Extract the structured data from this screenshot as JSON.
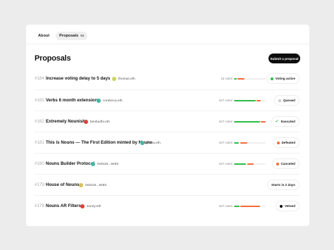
{
  "tabs": [
    {
      "label": "About",
      "count": ""
    },
    {
      "label": "Proposals",
      "count": "84"
    }
  ],
  "page_title": "Proposals",
  "submit_label": "Submit a proposal",
  "colors": {
    "for": "#2cbc46",
    "against": "#f26a3b",
    "active": "#2cbc46",
    "queued": "#c8c8c8",
    "defeated": "#f26a3b",
    "canceled": "#f26a3b",
    "vetoed": "#111111"
  },
  "proposals": [
    {
      "num": "#184",
      "title": "Increase voting delay to 5 days",
      "author": "thomas.eth",
      "avatar_color": "#c9d36a",
      "votes": "16 votes",
      "for": 0.08,
      "against": 0.22,
      "status": "Voting active",
      "status_icon": "dot-icon",
      "status_color": "#2cbc46"
    },
    {
      "num": "#183",
      "title": "Verbs 6 month extension",
      "author": "coralorca.eth",
      "avatar_color": "#43b6a3",
      "votes": "647 votes",
      "for": 0.68,
      "against": 0.14,
      "status": "Queued",
      "status_icon": "dot-icon",
      "status_color": "#c8c8c8"
    },
    {
      "num": "#182",
      "title": "Extremely Nounish",
      "author": "benbodhi.eth",
      "avatar_color": "#d9453b",
      "votes": "647 votes",
      "for": 0.82,
      "against": 0.14,
      "status": "Executed",
      "status_icon": "check-icon",
      "status_color": "#2cbc46"
    },
    {
      "num": "#181",
      "title": "This is Nouns — The First Edition minted by Nouns",
      "author": "jenna.eth",
      "avatar_color": "#43b6a3",
      "votes": "647 votes",
      "for": 0.16,
      "against": 0.24,
      "status": "Defeated",
      "status_icon": "dot-icon",
      "status_color": "#f26a3b"
    },
    {
      "num": "#180",
      "title": "Nouns Builder Protocol",
      "author": "0x9116...9483",
      "avatar_color": "#43b6a3",
      "votes": "647 votes",
      "for": 0.38,
      "against": 0.22,
      "status": "Canceled",
      "status_icon": "dot-icon",
      "status_color": "#f26a3b"
    },
    {
      "num": "#179",
      "title": "House of Nouns",
      "author": "0x9116...9483",
      "avatar_color": "#d6c25b",
      "votes": "",
      "for": 0,
      "against": 0,
      "status": "Starts in 2 days",
      "status_icon": "",
      "status_color": ""
    },
    {
      "num": "#178",
      "title": "Nouns AR Filters",
      "author": "sonny.eth",
      "avatar_color": "#d9453b",
      "votes": "647 votes",
      "for": 0.17,
      "against": 0.62,
      "status": "Vetoed",
      "status_icon": "dot-icon",
      "status_color": "#111111"
    }
  ]
}
